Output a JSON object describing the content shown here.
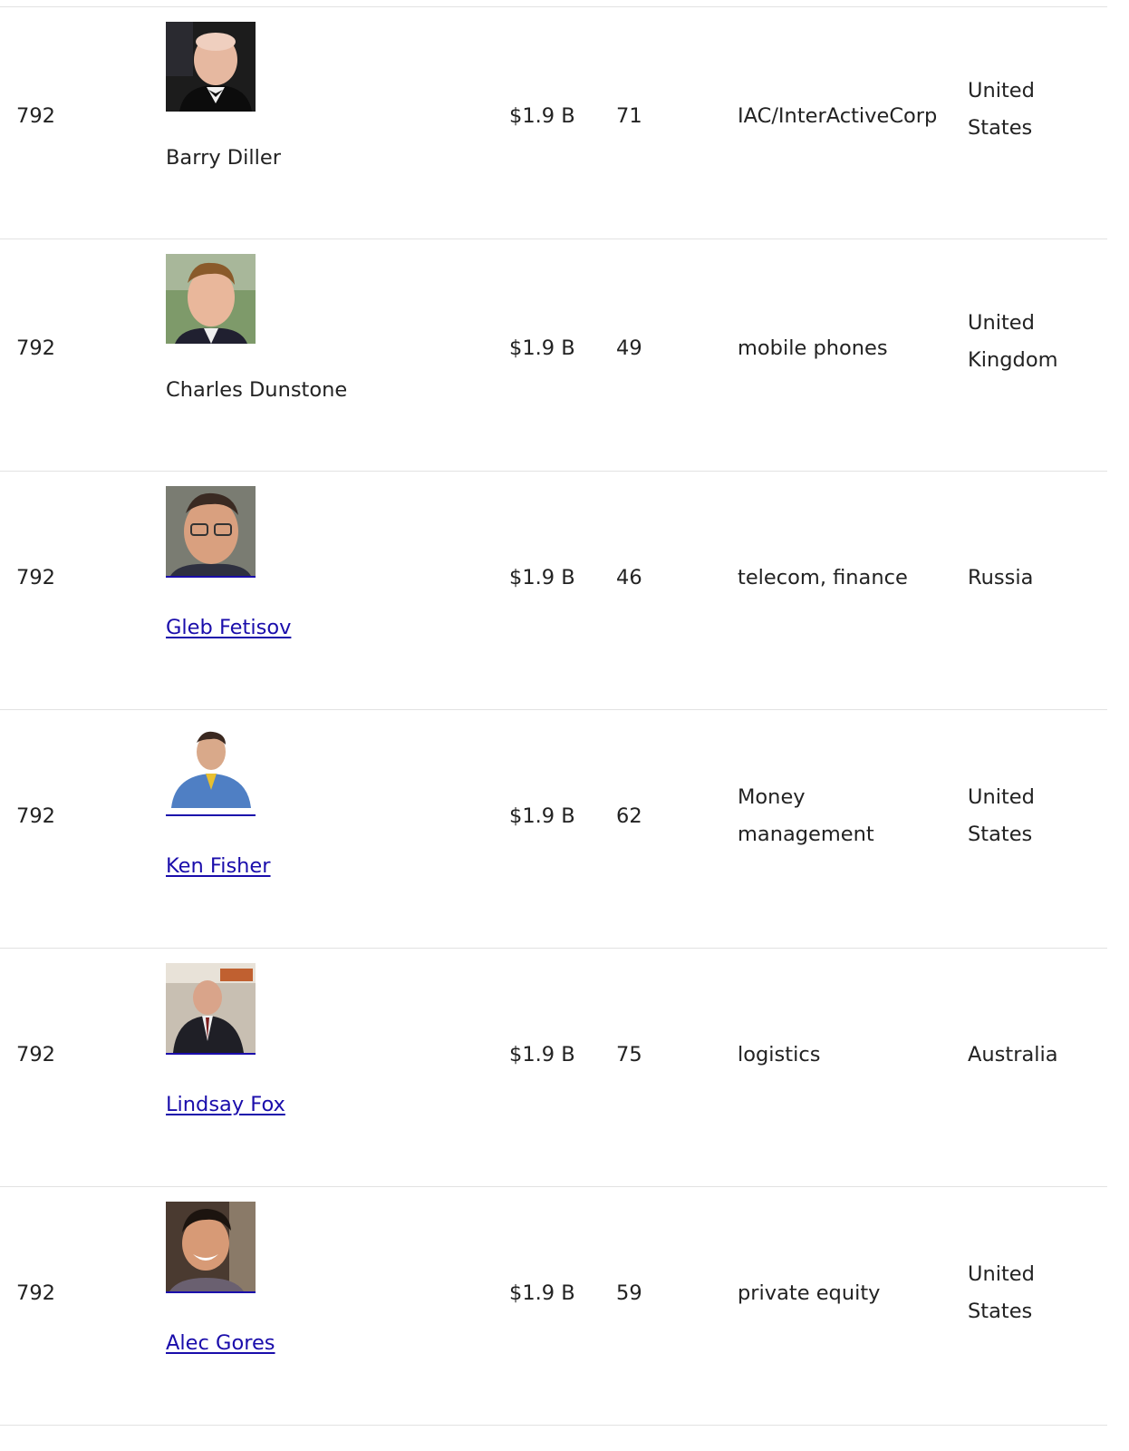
{
  "rows": [
    {
      "rank": "792",
      "name": "Barry Diller",
      "linked": false,
      "net_worth": "$1.9 B",
      "age": "71",
      "source": "IAC/InterActiveCorp",
      "country": [
        "United",
        "States"
      ],
      "photo_icon": "person-photo-tuxedo"
    },
    {
      "rank": "792",
      "name": "Charles Dunstone",
      "linked": false,
      "net_worth": "$1.9 B",
      "age": "49",
      "source": "mobile phones",
      "country": [
        "United",
        "Kingdom"
      ],
      "photo_icon": "person-photo-outdoor"
    },
    {
      "rank": "792",
      "name": "Gleb Fetisov",
      "linked": true,
      "net_worth": "$1.9 B",
      "age": "46",
      "source": "telecom, finance",
      "country": [
        "Russia"
      ],
      "photo_icon": "person-photo-glasses"
    },
    {
      "rank": "792",
      "name": "Ken Fisher",
      "linked": true,
      "net_worth": "$1.9 B",
      "age": "62",
      "source": [
        "Money",
        "management"
      ],
      "country": [
        "United",
        "States"
      ],
      "photo_icon": "person-photo-blue-shirt"
    },
    {
      "rank": "792",
      "name": "Lindsay Fox",
      "linked": true,
      "net_worth": "$1.9 B",
      "age": "75",
      "source": "logistics",
      "country": [
        "Australia"
      ],
      "photo_icon": "person-photo-event"
    },
    {
      "rank": "792",
      "name": "Alec Gores",
      "linked": true,
      "net_worth": "$1.9 B",
      "age": "59",
      "source": "private equity",
      "country": [
        "United",
        "States"
      ],
      "photo_icon": "person-photo-smiling"
    }
  ],
  "colors": {
    "link": "#1a0dab",
    "text": "#222222",
    "row_border": "#e2e2e2"
  }
}
